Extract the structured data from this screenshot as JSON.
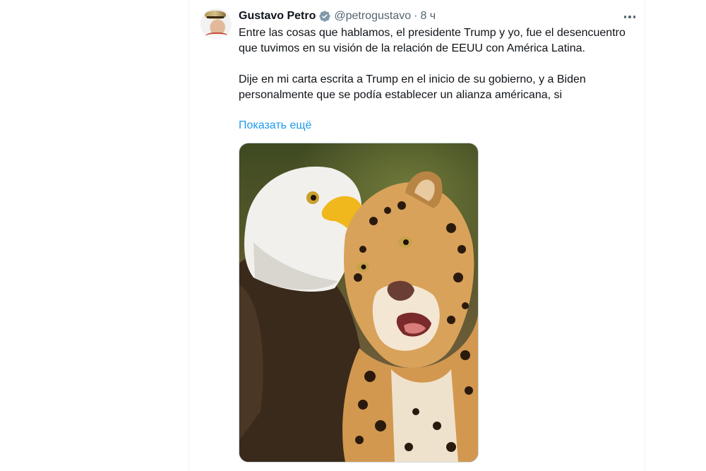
{
  "tweet": {
    "author_name": "Gustavo Petro",
    "handle": "@petrogustavo",
    "separator": "·",
    "time": "8 ч",
    "paragraphs": [
      "Entre las cosas que hablamos, el presidente Trump y yo, fue el desencuentro que tuvimos en su visión de la relación de EEUU con América Latina.",
      "Dije en mi carta escrita a Trump en el inicio de su gobierno, y a Biden personalmente que se podía establecer un alianza américana, si"
    ],
    "show_more_label": "Показать ещё",
    "media": {
      "description_icon": "eagle-and-jaguar-image"
    }
  },
  "colors": {
    "link": "#1d9bf0",
    "secondary_text": "#536471",
    "verified_badge": "#829aab",
    "divider": "#eff3f4"
  },
  "icons": {
    "verified": "verified-badge-icon",
    "more": "more-horizontal-icon"
  }
}
